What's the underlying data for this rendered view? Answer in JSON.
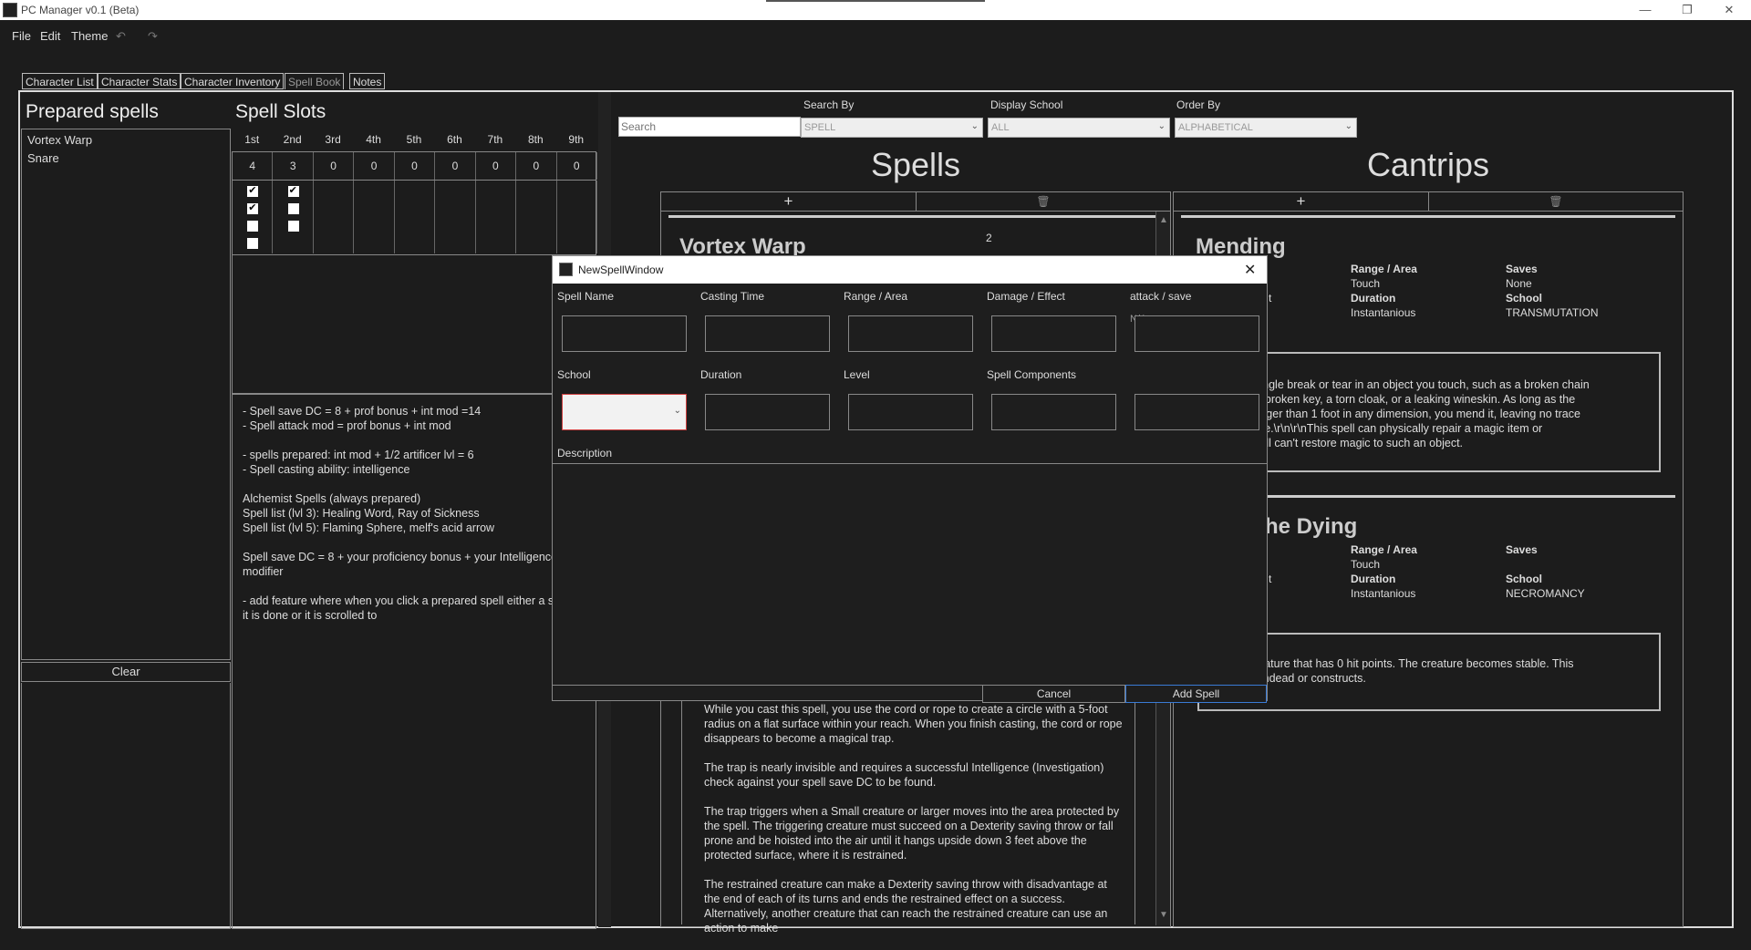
{
  "window": {
    "title": "PC Manager v0.1 (Beta)",
    "minimize_glyph": "—",
    "restore_glyph": "❐",
    "close_glyph": "✕"
  },
  "menu": {
    "items": [
      "File",
      "Edit",
      "Theme"
    ],
    "undo_glyph": "↶",
    "redo_glyph": "↷"
  },
  "tabs": [
    "Character List",
    "Character Stats",
    "Character Inventory",
    "Spell Book",
    "Notes"
  ],
  "active_tab": "Spell Book",
  "prepared": {
    "heading": "Prepared spells",
    "items": [
      "Vortex Warp",
      "Snare"
    ],
    "clear_label": "Clear"
  },
  "slots": {
    "heading": "Spell Slots",
    "levels": [
      "1st",
      "2nd",
      "3rd",
      "4th",
      "5th",
      "6th",
      "7th",
      "8th",
      "9th"
    ],
    "counts": [
      "4",
      "3",
      "0",
      "0",
      "0",
      "0",
      "0",
      "0",
      "0"
    ],
    "checks": [
      [
        true,
        true,
        false,
        false
      ],
      [
        true,
        false,
        false
      ]
    ]
  },
  "notes": [
    "- Spell save DC = 8 + prof bonus + int mod =14",
    "- Spell attack mod = prof bonus + int mod",
    "",
    "- spells prepared: int mod + 1/2 artificer lvl = 6",
    "- Spell casting ability: intelligence",
    "",
    "Alchemist Spells (always prepared)",
    "Spell list (lvl 3): Healing Word, Ray of Sickness",
    "Spell list (lvl 5): Flaming Sphere, melf's acid arrow",
    "",
    "Spell save DC = 8 + your proficiency bonus + your Intelligence",
    "modifier",
    "",
    "- add feature  where when you click a prepared spell either a sea",
    "it is done or it is scrolled to"
  ],
  "search": {
    "placeholder": "Search",
    "search_by_label": "Search By",
    "search_by_value": "SPELL",
    "display_school_label": "Display School",
    "display_school_value": "ALL",
    "order_by_label": "Order By",
    "order_by_value": "ALPHABETICAL"
  },
  "spells": {
    "heading": "Spells",
    "add_glyph": "+",
    "delete_glyph": "🗑",
    "card_title": "Vortex Warp",
    "card_level": "2",
    "lower_paragraphs": [
      "While you cast this spell, you use the cord or rope to create a circle with a 5-foot radius on a flat surface within your reach. When you finish casting, the cord or rope disappears to become a magical trap.",
      "The trap is nearly invisible and requires a successful Intelligence (Investigation) check against your spell save DC to be found.",
      "The trap triggers when a Small creature or larger moves into the area protected by the spell. The triggering creature must succeed on a Dexterity saving throw or fall prone and be hoisted into the air until it hangs upside down 3 feet above the protected surface, where it is restrained.",
      "The restrained creature can make a Dexterity saving throw with disadvantage at the end of each of its turns and ends the restrained effect on a success. Alternatively, another creature that can reach the restrained creature can use an action to make"
    ]
  },
  "cantrips": {
    "heading": "Cantrips",
    "add_glyph": "+",
    "delete_glyph": "🗑",
    "card1": {
      "title": "Mending",
      "t_frag": "t",
      "range_label": "Range / Area",
      "range_value": "Touch",
      "duration_label": "Duration",
      "duration_value": "Instantanious",
      "saves_label": "Saves",
      "saves_value": "None",
      "school_label": "School",
      "school_value": "TRANSMUTATION",
      "desc_lines": [
        "repairs a single break or tear in an object you touch, such as a broken chain",
        "halves of a broken key, a torn cloak, or a leaking wineskin. As long as the",
        "ear is no larger than 1 foot in any dimension, you mend it, leaving no trace",
        "mer damage.\\r\\n\\r\\nThis spell can physically repair a magic item or",
        " but the spell can't restore magic to such an object."
      ]
    },
    "card2": {
      "title": "he Dying",
      "t_frag": "t",
      "range_label": "Range / Area",
      "range_value": "Touch",
      "duration_label": "Duration",
      "duration_value": "Instantanious",
      "saves_label": "Saves",
      "school_label": "School",
      "school_value": "NECROMANCY",
      "desc_lines": [
        " a living creature that has 0 hit points. The creature becomes stable. This",
        " effect on undead or constructs."
      ]
    }
  },
  "dialog": {
    "title": "NewSpellWindow",
    "close_glyph": "✕",
    "labels": {
      "spell_name": "Spell Name",
      "casting_time": "Casting Time",
      "range_area": "Range / Area",
      "damage_effect": "Damage / Effect",
      "attack_save": "attack / save",
      "school": "School",
      "duration": "Duration",
      "level": "Level",
      "spell_components": "Spell Components",
      "description": "Description"
    },
    "attack_save_value": "N/A",
    "cancel_label": "Cancel",
    "add_label": "Add Spell"
  },
  "colors": {
    "background": "#1c1c1c",
    "dialog_school_border": "#d04040",
    "add_button_border": "#3a7bd5"
  }
}
